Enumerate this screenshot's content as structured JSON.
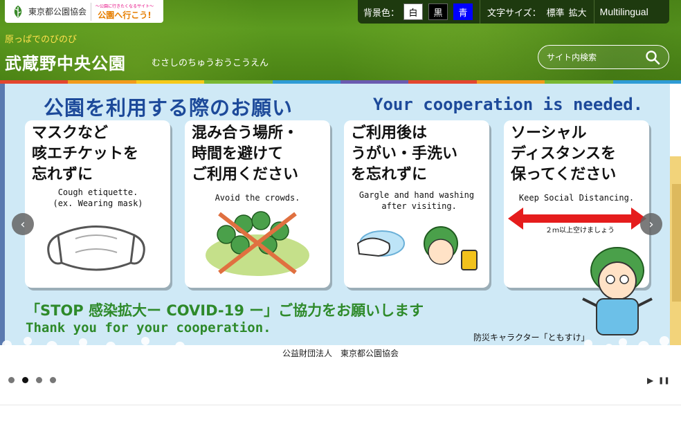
{
  "header": {
    "org_logo_text": "東京都公園協会",
    "portal_logo_small": "〜公園に行きたくなるサイト〜",
    "portal_logo_main": "公園へ行こう!",
    "tagline": "原っぱでのびのび",
    "site_name": "武蔵野中央公園",
    "site_name_kana": "むさしのちゅうおうこうえん",
    "search": {
      "placeholder": "サイト内検索"
    }
  },
  "toolbar": {
    "bg_color_label": "背景色：",
    "bg_white": "白",
    "bg_black": "黒",
    "bg_blue": "青",
    "font_size_label": "文字サイズ：",
    "font_standard": "標準",
    "font_large": "拡大",
    "multilingual": "Multilingual"
  },
  "stripe_colors": [
    "#e3462f",
    "#f29b1c",
    "#f6c91a",
    "#79b833",
    "#2e9bd5",
    "#6a5bb0",
    "#e3462f",
    "#f29b1c",
    "#79b833",
    "#2e9bd5"
  ],
  "banner": {
    "title_jp": "公園を利用する際のお願い",
    "title_en": "Your cooperation is needed.",
    "cards": [
      {
        "jp": "マスクなど\n咳エチケットを\n忘れずに",
        "en": "Cough etiquette.\n(ex. Wearing mask)"
      },
      {
        "jp": "混み合う場所・\n時間を避けて\nご利用ください",
        "en": "Avoid the crowds."
      },
      {
        "jp": "ご利用後は\nうがい・手洗い\nを忘れずに",
        "en": "Gargle and hand washing\n after visiting."
      },
      {
        "jp": "ソーシャル\nディスタンスを\n保ってください",
        "en": "Keep Social Distancing.",
        "distance_note": "２ｍ以上空けましょう"
      }
    ],
    "footer_jp": "「STOP 感染拡大ー COVID-19 ー」ご協力をお願いします",
    "footer_en": "Thank you for your cooperation.",
    "character_note": "防災キャラクター「ともすけ」",
    "organization": "公益財団法人　東京都公園協会"
  },
  "slider": {
    "prev_label": "‹",
    "next_label": "›",
    "play_label": "▶",
    "pause_label": "❚❚",
    "dots": 4,
    "active_dot": 2
  }
}
